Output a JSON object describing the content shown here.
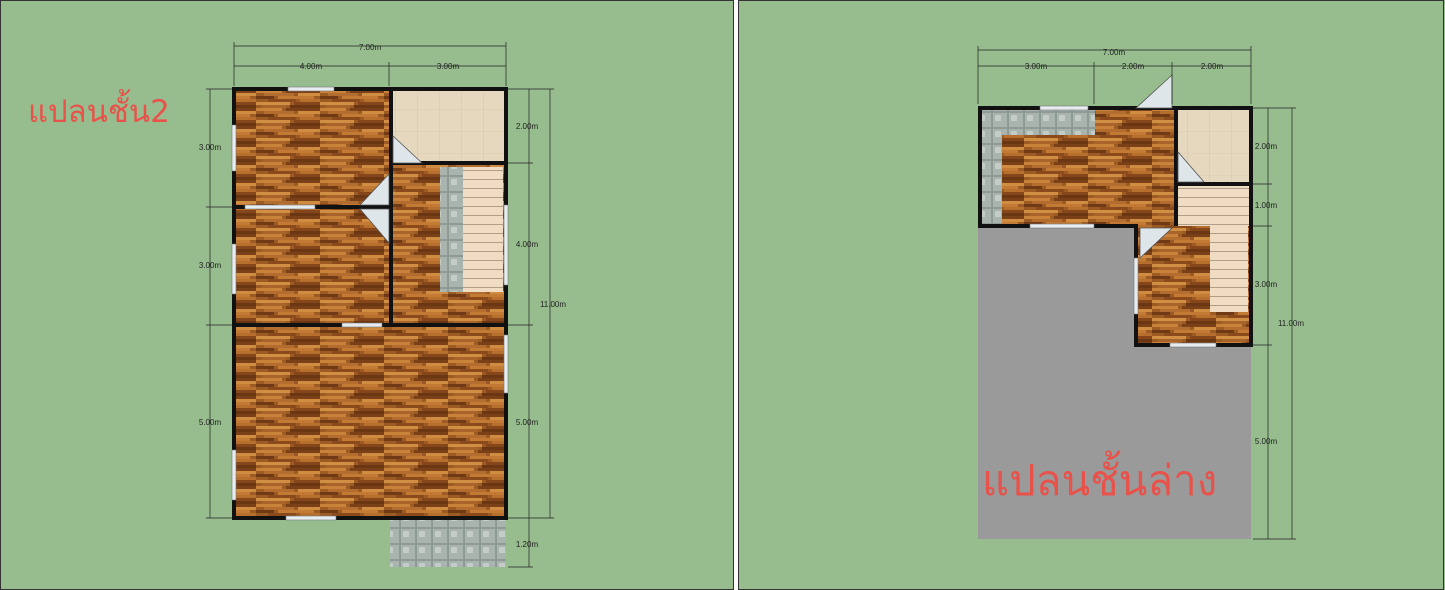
{
  "panels": {
    "upper": {
      "title": "แปลนชั้น2",
      "dims_top": {
        "total": "7.00m",
        "a": "4.00m",
        "b": "3.00m"
      },
      "dims_left": {
        "a": "3.00m",
        "b": "3.00m",
        "c": "5.00m"
      },
      "dims_right": {
        "a": "2.00m",
        "b": "4.00m",
        "c": "5.00m",
        "d": "1.20m",
        "total": "11.00m"
      }
    },
    "ground": {
      "title": "แปลนชั้นล่าง",
      "dims_top": {
        "total": "7.00m",
        "a": "3.00m",
        "b": "2.00m",
        "c": "2.00m"
      },
      "dims_right": {
        "a": "2.00m",
        "b": "1.00m",
        "c": "3.00m",
        "d": "5.00m",
        "total": "11.00m"
      }
    }
  },
  "colors": {
    "background": "#97bd8e",
    "wood": "#9a5a22",
    "tile": "#e6d8bf",
    "slab": "#9a9a9a",
    "wall": "#111111",
    "title": "#e8524a"
  }
}
